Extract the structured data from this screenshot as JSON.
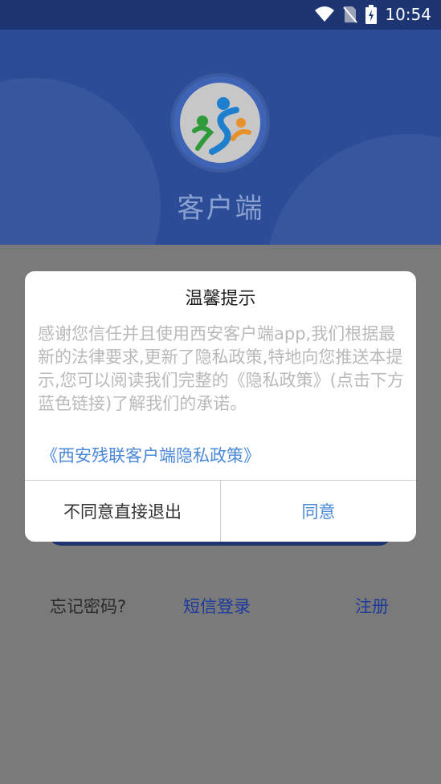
{
  "status": {
    "time": "10:54"
  },
  "app": {
    "title": "客户端"
  },
  "links": {
    "forgot": "忘记密码?",
    "sms": "短信登录",
    "register": "注册"
  },
  "dialog": {
    "title": "温馨提示",
    "body": "感谢您信任并且使用西安客户端app,我们根据最新的法律要求,更新了隐私政策,特地向您推送本提示,您可以阅读我们完整的《隐私政策》(点击下方蓝色链接)了解我们的承诺。",
    "link": "《西安残联客户端隐私政策》",
    "disagree": "不同意直接退出",
    "agree": "同意"
  },
  "colors": {
    "header": "#2c4c98",
    "statusbar": "#1d3673",
    "link": "#4a88d9",
    "overlay": "#7a7a7a"
  }
}
